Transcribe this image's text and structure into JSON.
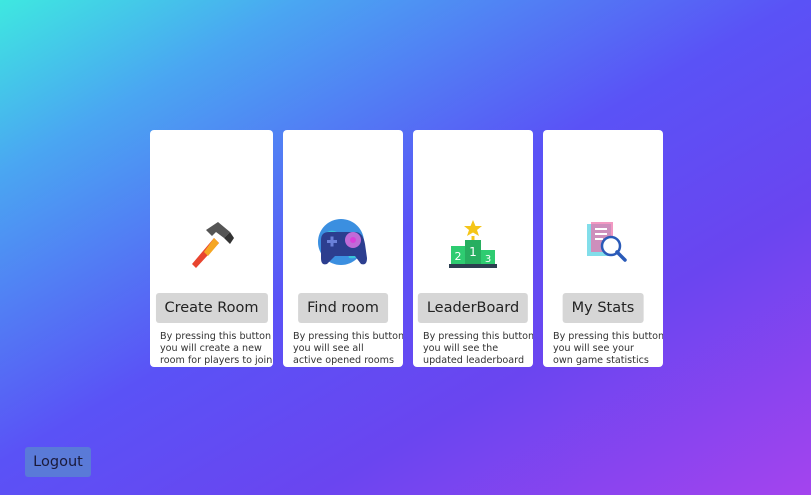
{
  "cards": [
    {
      "button": "Create Room",
      "desc": "By pressing this button\nyou will create a new\nroom for players to join",
      "icon": "hammer-icon"
    },
    {
      "button": "Find room",
      "desc": "By pressing this button\nyou will see all\nactive opened rooms",
      "icon": "gamepad-globe-icon"
    },
    {
      "button": "LeaderBoard",
      "desc": "By pressing this button\nyou will see the\nupdated leaderboard",
      "icon": "podium-icon"
    },
    {
      "button": "My Stats",
      "desc": "By pressing this button\nyou will see your\nown game statistics",
      "icon": "document-search-icon"
    }
  ],
  "logout_label": "Logout"
}
